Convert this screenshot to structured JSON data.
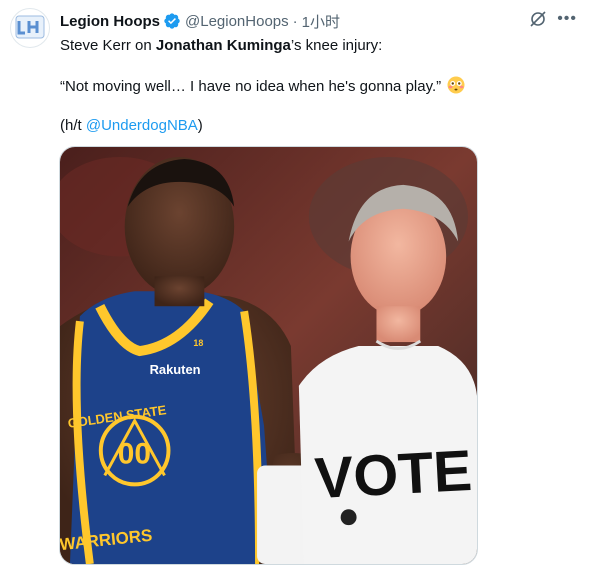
{
  "tweet": {
    "display_name": "Legion Hoops",
    "handle": "@LegionHoops",
    "separator": "·",
    "time": "1小时",
    "text": {
      "line1_pre": "Steve Kerr on ",
      "line1_bold": "Jonathan Kuminga",
      "line1_post": "’s knee injury:",
      "quote": "“Not moving well… I have no idea when he's gonna play.”",
      "credit_pre": "(h/t ",
      "credit_mention": "@UnderdogNBA",
      "credit_post": ")"
    },
    "media": {
      "jersey_brand": "Rakuten",
      "jersey_team": "GOLDEN STATE",
      "jersey_number": "00",
      "jersey_bottom": "WARRIORS",
      "shirt_text": "VOTE",
      "jersey_patch": "18"
    }
  },
  "icons": {
    "verified": "verified-badge-icon",
    "grok": "grok-icon",
    "more": "more-icon",
    "emoji": "flushed-face-emoji-icon"
  },
  "colors": {
    "accent": "#1d9bf0",
    "warriors_blue": "#1d428a",
    "warriors_gold": "#ffc72c"
  }
}
